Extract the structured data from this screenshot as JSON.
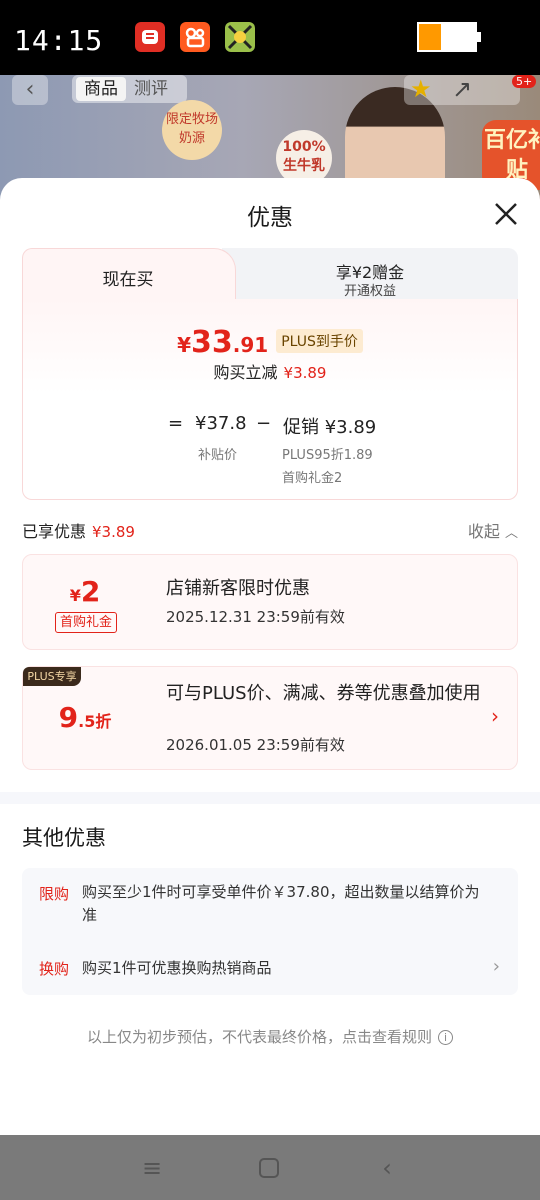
{
  "status_bar": {
    "time": "14:15",
    "battery_level": 0.4
  },
  "background_page": {
    "tabs": [
      "商品",
      "测评"
    ],
    "badge_1": "限定牧场奶源",
    "badge_2": "100%生牛乳",
    "cart_count": "5+",
    "promo": "百亿补贴"
  },
  "sheet": {
    "title": "优惠",
    "tabs": {
      "active": "现在买",
      "inactive_main": "享¥2赠金",
      "inactive_sub": "开通权益"
    },
    "price": {
      "yen": "¥",
      "integer": "33",
      "decimal": ".91",
      "tag": "PLUS到手价"
    },
    "saving": {
      "label": "购买立减",
      "amount": "¥3.89"
    },
    "formula": {
      "equals": "=",
      "base": "¥37.8",
      "base_label": "补贴价",
      "minus": "−",
      "promo": "促销 ¥3.89",
      "promo_detail_1": "PLUS95折1.89",
      "promo_detail_2": "首购礼金2"
    },
    "enjoyed": {
      "label": "已享优惠",
      "amount": "¥3.89",
      "toggle": "收起"
    },
    "coupons": [
      {
        "amount_symbol": "¥",
        "amount": "2",
        "tag": "首购礼金",
        "title": "店铺新客限时优惠",
        "validity": "2025.12.31 23:59前有效"
      },
      {
        "corner": "PLUS专享",
        "amount": "9",
        "amount_suffix": ".5折",
        "title": "可与PLUS价、满减、券等优惠叠加使用",
        "validity": "2026.01.05 23:59前有效"
      }
    ],
    "other": {
      "title": "其他优惠",
      "items": [
        {
          "tag": "限购",
          "text": "购买至少1件时可享受单件价￥37.80，超出数量以结算价为准"
        },
        {
          "tag": "换购",
          "text": "购买1件可优惠换购热销商品"
        }
      ]
    },
    "disclaimer": "以上仅为初步预估，不代表最终价格，点击查看规则"
  },
  "colors": {
    "accent": "#e2231a",
    "plus_gold": "#f4d8a6",
    "sheet_bg": "#ffffff"
  }
}
